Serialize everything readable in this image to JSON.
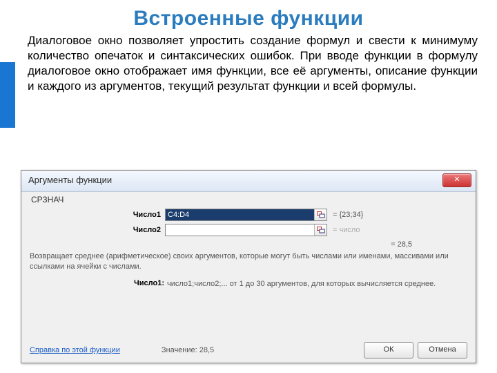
{
  "heading": "Встроенные функции",
  "paragraph": "Диалоговое окно позволяет упростить создание формул и свести к минимуму количество опечаток и синтаксических ошибок. При вводе функции в формулу диалоговое окно отображает имя функции, все её аргументы, описание функции и каждого из аргументов, текущий результат функции и всей формулы.",
  "dialog": {
    "title": "Аргументы функции",
    "close": "✕",
    "function_name": "СРЗНАЧ",
    "args": {
      "row1": {
        "label": "Число1",
        "value": "C4:D4",
        "result": "= {23;34}"
      },
      "row2": {
        "label": "Число2",
        "value": "",
        "result": "= число"
      }
    },
    "result_line": "= 28,5",
    "description": "Возвращает среднее (арифметическое) своих аргументов, которые могут быть числами или именами, массивами или ссылками на ячейки с числами.",
    "arg_help": {
      "label": "Число1:",
      "text": "число1;число2;... от 1 до 30 аргументов, для которых вычисляется среднее."
    },
    "help_link": "Справка по этой функции",
    "value_label": "Значение: 28,5",
    "ok": "ОК",
    "cancel": "Отмена"
  }
}
